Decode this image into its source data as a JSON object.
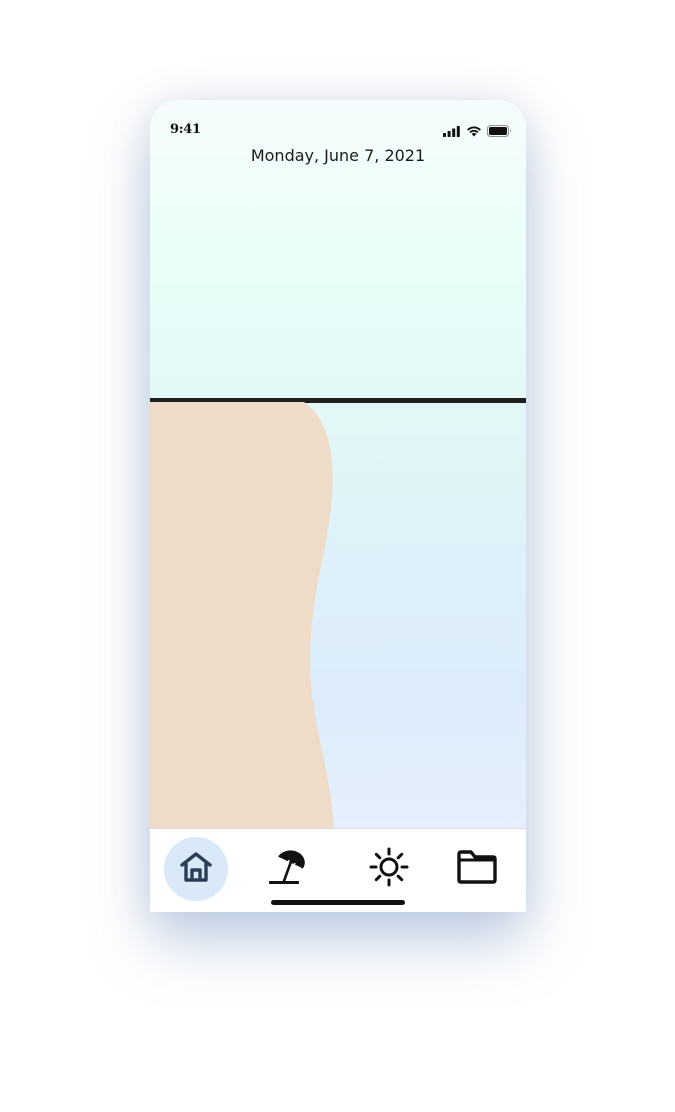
{
  "status_bar": {
    "time": "9:41"
  },
  "header": {
    "date": "Monday, June 7, 2021"
  },
  "nav": {
    "items": [
      {
        "icon": "home-icon",
        "active": true
      },
      {
        "icon": "beach-umbrella-icon",
        "active": false
      },
      {
        "icon": "sun-icon",
        "active": false
      },
      {
        "icon": "folder-icon",
        "active": false
      }
    ]
  },
  "colors": {
    "sand": "#efdcc8",
    "horizon": "#1f1f1f",
    "active_nav_bg": "#d9e9f8",
    "home_icon": "#2c3e55"
  }
}
